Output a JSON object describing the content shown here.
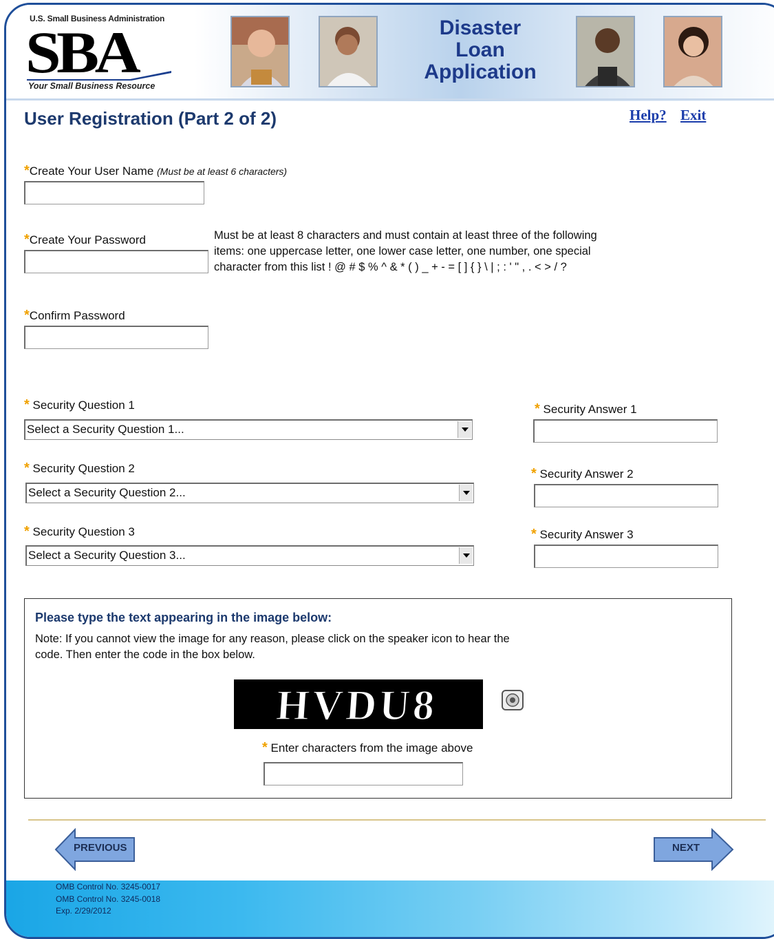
{
  "header": {
    "agency_small": "U.S. Small Business Administration",
    "logo_text": "SBA",
    "tagline": "Your Small Business Resource",
    "app_title_lines": [
      "Disaster",
      "Loan",
      "Application"
    ]
  },
  "page": {
    "title": "User Registration (Part 2 of 2)",
    "help_link": "Help?",
    "exit_link": "Exit"
  },
  "form": {
    "required_mark": "*",
    "username": {
      "label": "Create Your User Name",
      "hint": "(Must be at least 6 characters)",
      "value": ""
    },
    "password": {
      "label": "Create Your Password",
      "value": "",
      "help_lines": [
        "Must be at least 8 characters and must contain at least three of the following",
        "items: one uppercase letter, one lower case letter, one number, one special",
        "character from this list ! @ # $ % ^ & * ( ) _ + - = [ ] { } \\ | ; : ' \" , . < > / ?"
      ]
    },
    "confirm_password": {
      "label": "Confirm Password",
      "value": ""
    },
    "security": [
      {
        "question_label": "Security Question 1",
        "selected": "Select a Security Question 1...",
        "answer_label": "Security Answer 1",
        "answer_value": ""
      },
      {
        "question_label": "Security Question 2",
        "selected": "Select a Security Question 2...",
        "answer_label": "Security Answer 2",
        "answer_value": ""
      },
      {
        "question_label": "Security Question 3",
        "selected": "Select a Security Question 3...",
        "answer_label": "Security Answer 3",
        "answer_value": ""
      }
    ]
  },
  "captcha": {
    "heading": "Please type the text appearing in the image below:",
    "note_lines": [
      "Note: If you cannot view the image for any reason, please click on the speaker icon to hear the",
      "code.  Then enter the code in the box below."
    ],
    "code_text": "HVDU8",
    "speaker_icon": "speaker-icon",
    "input_label": "Enter characters from the image above",
    "input_value": ""
  },
  "nav": {
    "previous_label": "PREVIOUS",
    "next_label": "NEXT",
    "arrow_color": "#7fa6df"
  },
  "footer": {
    "lines": [
      "OMB Control No. 3245-0017",
      "OMB Control No. 3245-0018",
      "Exp. 2/29/2012"
    ]
  },
  "colors": {
    "brand_blue": "#1d3a6e",
    "required": "#f0a100",
    "link": "#1b3dab"
  }
}
